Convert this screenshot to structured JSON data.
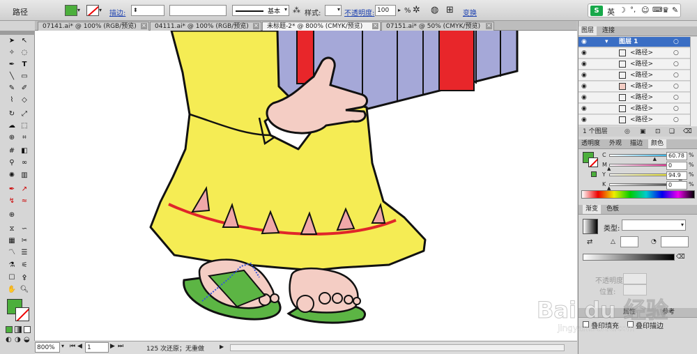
{
  "control_bar": {
    "object_type": "路径",
    "stroke_label": "描边:",
    "stroke_profile": "基本",
    "style_label": "样式:",
    "opacity_label": "不透明度:",
    "opacity_value": "100",
    "opacity_unit": "%",
    "transform_link": "变换",
    "fill_color": "#4caf3c"
  },
  "ime_toolbar": {
    "logo": "S",
    "mode": "英"
  },
  "doc_tabs": [
    {
      "label": "07141.ai* @ 100% (RGB/预览)"
    },
    {
      "label": "04111.ai* @ 100% (RGB/预览)"
    },
    {
      "label": "未标题-2* @ 800% (CMYK/预览)"
    },
    {
      "label": "07151.ai* @ 50% (CMYK/预览)"
    }
  ],
  "status_bar": {
    "zoom": "800%",
    "artboard": "1",
    "history": "125 次还原；无重做"
  },
  "layers_panel": {
    "tabs": [
      "图层",
      "连接"
    ],
    "layer_name": "图层 1",
    "items": [
      "<路径>",
      "<路径>",
      "<路径>",
      "<路径>",
      "<路径>",
      "<路径>",
      "<路径>"
    ],
    "footer": "1 个图层"
  },
  "color_panel": {
    "tabs": [
      "透明度",
      "外观",
      "描边",
      "颜色"
    ],
    "channels": [
      {
        "label": "C",
        "value": "60.78",
        "unit": "%",
        "fraction": 0.6078,
        "color": "#00a0e0"
      },
      {
        "label": "M",
        "value": "0",
        "unit": "%",
        "fraction": 0,
        "color": "#e0007a"
      },
      {
        "label": "Y",
        "value": "94.9",
        "unit": "%",
        "fraction": 0.949,
        "color": "#e8e000"
      },
      {
        "label": "K",
        "value": "0",
        "unit": "%",
        "fraction": 0,
        "color": "#222222"
      }
    ]
  },
  "gradient_panel": {
    "tabs": [
      "渐变",
      "色板"
    ],
    "type_label": "类型:",
    "opacity_label": "不透明度:",
    "position_label": "位置:"
  },
  "watermark": {
    "brand": "Bai du 经验",
    "url": "jingyan.baidu.com"
  },
  "bottom_panel": {
    "tab": "属性",
    "tab2": "参考",
    "overprint_fill": "叠印填充",
    "overprint_stroke": "叠印描边"
  },
  "colors": {
    "robe": "#f5ec54",
    "skin": "#f4cdc4",
    "triangle": "#f0a8a8",
    "sash": "#e0262a",
    "sandal": "#5cb544",
    "box": "#a5a8d8",
    "box_stripe": "#e8262a",
    "selection": "#3355dd"
  }
}
